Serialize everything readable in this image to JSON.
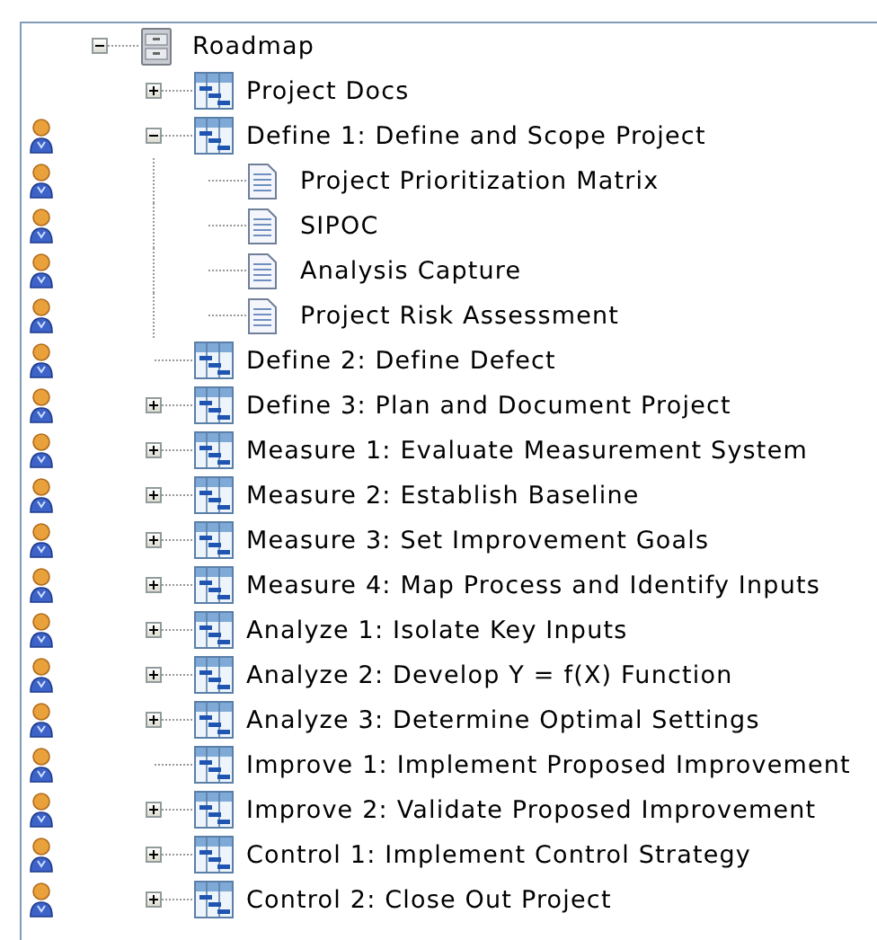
{
  "tree": {
    "label": "Roadmap",
    "kind": "roadmap",
    "expanded": true,
    "has_owner": false,
    "children": [
      {
        "label": "Project Docs",
        "kind": "phase",
        "expanded": false,
        "has_owner": false
      },
      {
        "label": "Define 1: Define and Scope Project",
        "kind": "phase",
        "expanded": true,
        "has_owner": true,
        "children": [
          {
            "label": "Project Prioritization Matrix",
            "kind": "document",
            "has_owner": true
          },
          {
            "label": "SIPOC",
            "kind": "document",
            "has_owner": true
          },
          {
            "label": "Analysis Capture",
            "kind": "document",
            "has_owner": true
          },
          {
            "label": "Project Risk Assessment",
            "kind": "document",
            "has_owner": true
          }
        ]
      },
      {
        "label": "Define 2: Define Defect",
        "kind": "phase",
        "has_owner": true
      },
      {
        "label": "Define 3: Plan and Document Project",
        "kind": "phase",
        "expanded": false,
        "has_owner": true
      },
      {
        "label": "Measure 1: Evaluate Measurement System",
        "kind": "phase",
        "expanded": false,
        "has_owner": true
      },
      {
        "label": "Measure 2: Establish Baseline",
        "kind": "phase",
        "expanded": false,
        "has_owner": true
      },
      {
        "label": "Measure 3: Set Improvement Goals",
        "kind": "phase",
        "expanded": false,
        "has_owner": true
      },
      {
        "label": "Measure 4: Map Process and Identify Inputs",
        "kind": "phase",
        "expanded": false,
        "has_owner": true
      },
      {
        "label": "Analyze 1: Isolate Key Inputs",
        "kind": "phase",
        "expanded": false,
        "has_owner": true
      },
      {
        "label": "Analyze 2: Develop Y = f(X) Function",
        "kind": "phase",
        "expanded": false,
        "has_owner": true
      },
      {
        "label": "Analyze 3: Determine Optimal Settings",
        "kind": "phase",
        "expanded": false,
        "has_owner": true
      },
      {
        "label": "Improve 1: Implement Proposed Improvement",
        "kind": "phase",
        "has_owner": true
      },
      {
        "label": "Improve 2: Validate Proposed Improvement",
        "kind": "phase",
        "expanded": false,
        "has_owner": true
      },
      {
        "label": "Control 1: Implement Control Strategy",
        "kind": "phase",
        "expanded": false,
        "has_owner": true
      },
      {
        "label": "Control 2: Close Out Project",
        "kind": "phase",
        "expanded": false,
        "has_owner": true
      }
    ]
  }
}
